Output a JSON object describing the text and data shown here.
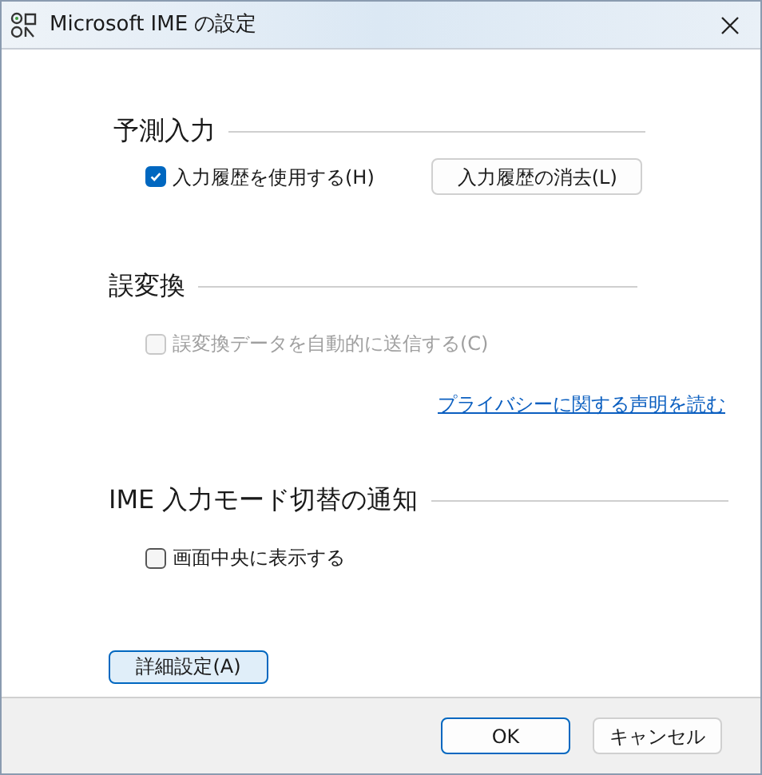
{
  "window": {
    "title": "Microsoft IME の設定"
  },
  "sections": [
    {
      "heading": "予測入力",
      "rows": [
        [
          {
            "kind": "checkbox",
            "label": "入力履歴を使用する(H)",
            "checked": true,
            "disabled": false
          },
          {
            "kind": "button",
            "label": "入力履歴の消去(L)"
          }
        ]
      ]
    },
    {
      "heading": "誤変換",
      "rows": [
        [
          {
            "kind": "checkbox",
            "label": "誤変換データを自動的に送信する(C)",
            "checked": false,
            "disabled": true
          }
        ],
        [
          {
            "kind": "link",
            "label": "プライバシーに関する声明を読む"
          }
        ]
      ]
    },
    {
      "heading": "IME 入力モード切替の通知",
      "rows": [
        [
          {
            "kind": "checkbox",
            "label": "画面中央に表示する",
            "checked": false,
            "disabled": false
          }
        ]
      ]
    }
  ],
  "advanced_button": {
    "label": "詳細設定(A)",
    "focused": true
  },
  "footer_buttons": [
    {
      "label": "OK",
      "default": true
    },
    {
      "label": "キャンセル",
      "default": false
    }
  ]
}
